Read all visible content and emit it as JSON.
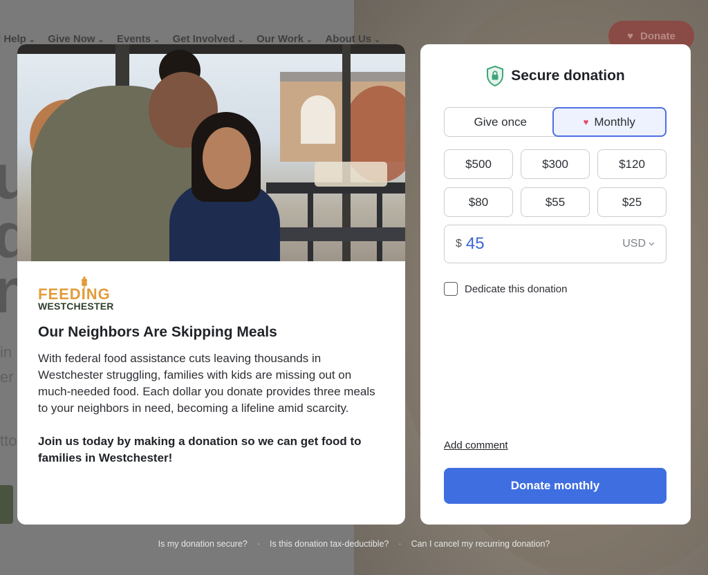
{
  "background": {
    "nav": [
      "d Help",
      "Give Now",
      "Events",
      "Get Involved",
      "Our Work",
      "About Us"
    ],
    "donate_button": "Donate",
    "big_letters": [
      "u",
      "d",
      "n"
    ],
    "side_fragments": [
      "in",
      "er",
      "tto"
    ]
  },
  "campaign": {
    "logo_top": "FEEDING",
    "logo_bottom": "WESTCHESTER",
    "headline": "Our Neighbors Are Skipping Meals",
    "description": "With federal food assistance cuts leaving thousands in Westchester struggling, families with kids are missing out on much-needed food. Each dollar you donate provides three meals to your neighbors in need, becoming a lifeline amid scarcity.",
    "call_to_action": "Join us today by making a donation so we can get food to families in Westchester!"
  },
  "donation": {
    "title": "Secure donation",
    "frequency": {
      "once_label": "Give once",
      "monthly_label": "Monthly",
      "selected": "Monthly"
    },
    "amount_options": [
      "$500",
      "$300",
      "$120",
      "$80",
      "$55",
      "$25"
    ],
    "currency_symbol": "$",
    "amount_value": "45",
    "currency_code": "USD",
    "dedicate_label": "Dedicate this donation",
    "dedicate_checked": false,
    "add_comment_label": "Add comment",
    "submit_label": "Donate monthly"
  },
  "faq_links": [
    "Is my donation secure?",
    "Is this donation tax-deductible?",
    "Can I cancel my recurring donation?"
  ],
  "colors": {
    "accent": "#3f6ee0",
    "heart": "#e8466c",
    "shield": "#3fa579",
    "logo_orange": "#e39b3a",
    "logo_green": "#2f3f2c"
  }
}
